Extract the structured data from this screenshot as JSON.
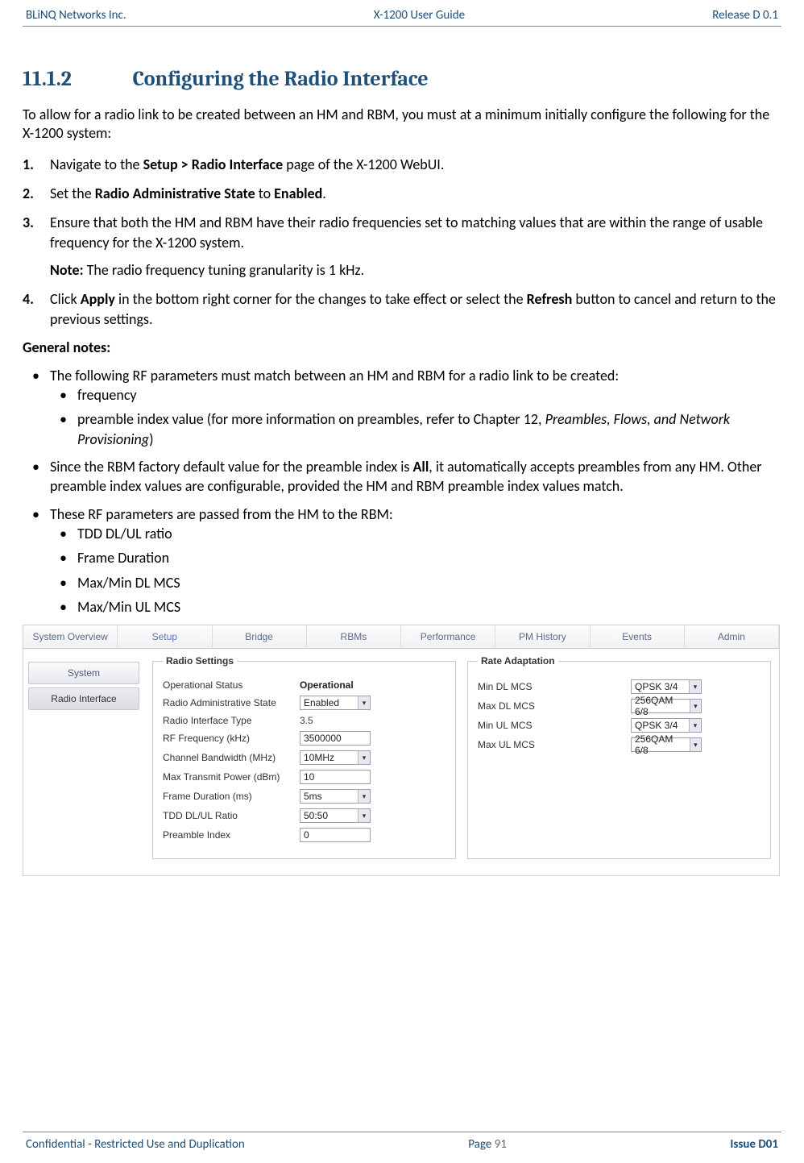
{
  "header": {
    "left": "BLiNQ Networks Inc.",
    "center": "X-1200 User Guide",
    "right": "Release D 0.1"
  },
  "footer": {
    "left": "Confidential - Restricted Use and Duplication",
    "page_label": "Page",
    "page_number": "91",
    "issue": "Issue D01"
  },
  "section": {
    "number": "11.1.2",
    "title": "Configuring the Radio Interface",
    "intro": "To allow for a radio link to be created between an HM and RBM, you must at a minimum initially configure the following for the X-1200 system:",
    "steps": {
      "s1_pre": "Navigate to the ",
      "s1_bold": "Setup > Radio Interface",
      "s1_post": " page of the X-1200 WebUI.",
      "s2_pre": "Set the ",
      "s2_bold1": "Radio Administrative State",
      "s2_mid": " to ",
      "s2_bold2": "Enabled",
      "s2_post": ".",
      "s3": "Ensure that both the HM and RBM have their radio frequencies set to matching values that are within the range of usable frequency for the X-1200 system.",
      "s3_note_label": "Note:",
      "s3_note_text": " The radio frequency tuning granularity is 1 kHz.",
      "s4_pre": "Click ",
      "s4_apply": "Apply",
      "s4_mid": " in the bottom right corner for the changes to take effect or select the ",
      "s4_refresh": "Refresh",
      "s4_post": " button to cancel and return to the previous settings."
    },
    "general_notes_label": "General notes:",
    "notes": {
      "n1": "The following RF parameters must match between an HM and RBM for a radio link to be created:",
      "n1a": "frequency",
      "n1b_pre": "preamble index value (for more information on preambles, refer to Chapter 12, ",
      "n1b_ital": "Preambles, Flows, and Network Provisioning",
      "n1b_post": ")",
      "n2_pre": "Since the RBM factory default value for the preamble index is ",
      "n2_bold": "All",
      "n2_post": ", it automatically accepts preambles from any HM. Other preamble index values are configurable, provided the HM and RBM preamble index values match.",
      "n3": "These RF parameters are passed from the HM to the RBM:",
      "n3a": "TDD DL/UL ratio",
      "n3b": "Frame Duration",
      "n3c": "Max/Min DL MCS",
      "n3d": "Max/Min UL MCS"
    }
  },
  "ui": {
    "tabs": [
      "System Overview",
      "Setup",
      "Bridge",
      "RBMs",
      "Performance",
      "PM History",
      "Events",
      "Admin"
    ],
    "sidebar": {
      "system": "System",
      "radio": "Radio Interface"
    },
    "radio_settings": {
      "legend": "Radio Settings",
      "op_status_lbl": "Operational Status",
      "op_status_val": "Operational",
      "admin_state_lbl": "Radio Administrative State",
      "admin_state_val": "Enabled",
      "if_type_lbl": "Radio Interface Type",
      "if_type_val": "3.5",
      "freq_lbl": "RF Frequency (kHz)",
      "freq_val": "3500000",
      "bw_lbl": "Channel Bandwidth (MHz)",
      "bw_val": "10MHz",
      "txp_lbl": "Max Transmit Power (dBm)",
      "txp_val": "10",
      "fd_lbl": "Frame Duration (ms)",
      "fd_val": "5ms",
      "tdd_lbl": "TDD DL/UL Ratio",
      "tdd_val": "50:50",
      "pi_lbl": "Preamble Index",
      "pi_val": "0"
    },
    "rate_adaptation": {
      "legend": "Rate Adaptation",
      "min_dl_lbl": "Min DL MCS",
      "min_dl_val": "QPSK 3/4",
      "max_dl_lbl": "Max DL MCS",
      "max_dl_val": "256QAM 6/8",
      "min_ul_lbl": "Min UL MCS",
      "min_ul_val": "QPSK 3/4",
      "max_ul_lbl": "Max UL MCS",
      "max_ul_val": "256QAM 6/8"
    }
  }
}
